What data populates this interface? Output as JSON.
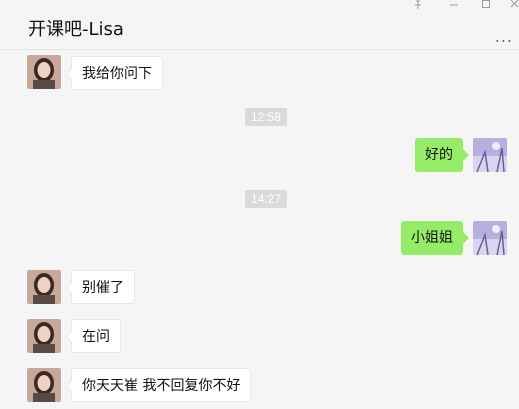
{
  "header": {
    "title": "开课吧-Lisa",
    "pin_icon": "pin-icon",
    "minimize_icon": "minimize-icon",
    "maximize_icon": "maximize-icon",
    "close_icon": "close-icon",
    "more_icon": "more-options-icon",
    "more_glyph": "..."
  },
  "messages": [
    {
      "side": "left",
      "text": "我给你问下"
    },
    {
      "type": "time",
      "text": "12:58"
    },
    {
      "side": "right",
      "text": "好的"
    },
    {
      "type": "time",
      "text": "14:27"
    },
    {
      "side": "right",
      "text": "小姐姐"
    },
    {
      "side": "left",
      "text": "别催了"
    },
    {
      "side": "left",
      "text": "在问"
    },
    {
      "side": "left",
      "text": "你天天崔  我不回复你不好"
    }
  ],
  "colors": {
    "background": "#f5f5f5",
    "sent_bubble": "#95ec69",
    "received_bubble": "#ffffff",
    "timestamp_bg": "#dadada"
  }
}
